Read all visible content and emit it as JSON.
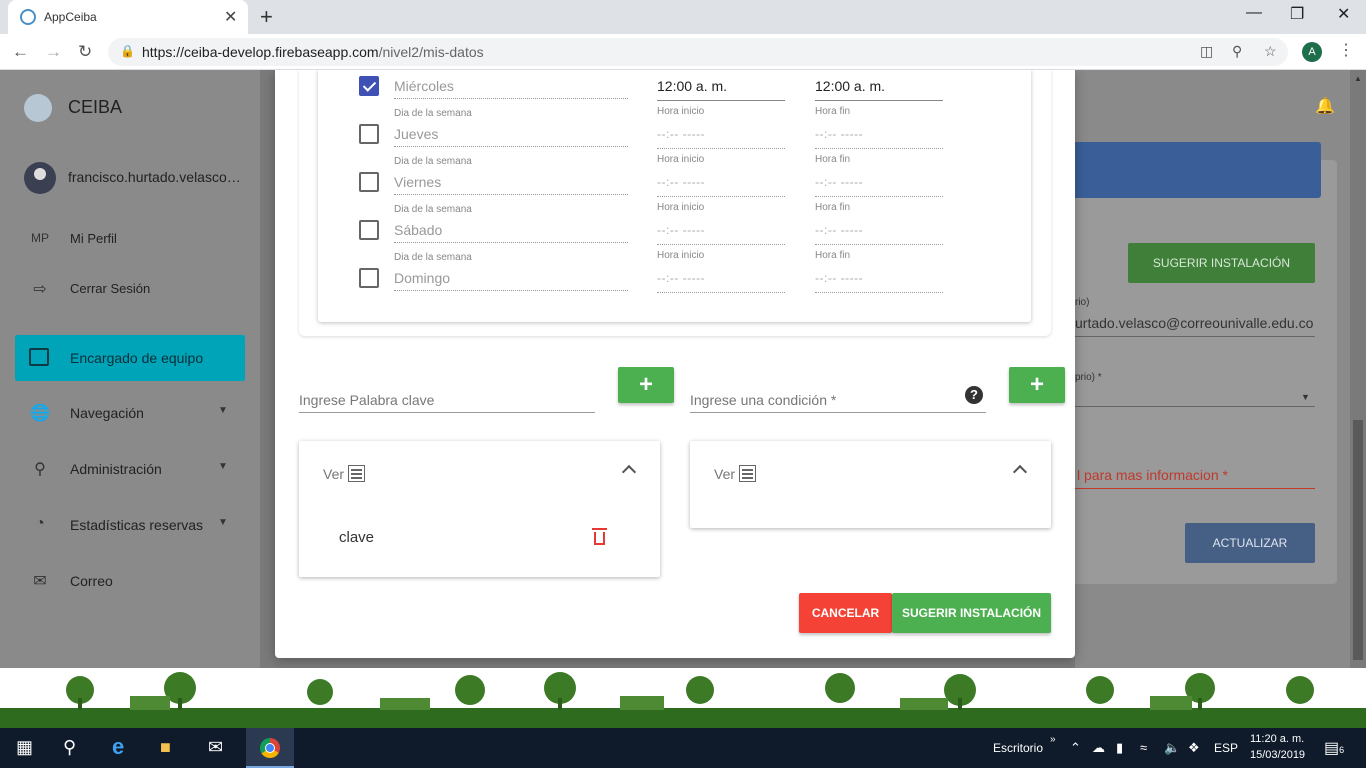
{
  "browser": {
    "tab_title": "AppCeiba",
    "tab_close": "✕",
    "new_tab": "+",
    "url_host": "https://ceiba-develop.firebaseapp.com",
    "url_path": "/nivel2/mis-datos",
    "avatar_letter": "A"
  },
  "sidebar": {
    "brand": "CEIBA",
    "user_name": "francisco.hurtado.velasco@correounivalle.edu.co",
    "profile_initials": "MP",
    "profile_label": "Mi Perfil",
    "logout_label": "Cerrar Sesión",
    "active_item": "Encargado de equipo",
    "items": [
      {
        "label": "Navegación",
        "icon": "globe-icon"
      },
      {
        "label": "Administración",
        "icon": "hierarchy-icon"
      },
      {
        "label": "Estadísticas reservas",
        "icon": "pie-icon"
      },
      {
        "label": "Correo",
        "icon": "mail-icon"
      }
    ]
  },
  "background": {
    "suggest_button": "SUGERIR INSTALACIÓN",
    "field1_label": "rio)",
    "field1_value": "urtado.velasco@correounivalle.edu.co",
    "field2_label": "prio) *",
    "red_field": "l para mas informacion *",
    "update_button": "ACTUALIZAR"
  },
  "schedule": {
    "day_caption": "Dia de la semana",
    "start_caption": "Hora inicio",
    "end_caption": "Hora fin",
    "time_placeholder": "--:-- -----",
    "rows": [
      {
        "day": "Miércoles",
        "checked": true,
        "start": "12:00 a. m.",
        "end": "12:00 a. m."
      },
      {
        "day": "Jueves",
        "checked": false
      },
      {
        "day": "Viernes",
        "checked": false
      },
      {
        "day": "Sábado",
        "checked": false
      },
      {
        "day": "Domingo",
        "checked": false
      }
    ]
  },
  "form": {
    "keyword_placeholder": "Ingrese Palabra clave",
    "condition_placeholder": "Ingrese una condición *",
    "plus": "+",
    "help": "?",
    "panel_label": "Ver",
    "keywords": [
      "clave"
    ],
    "cancel_button": "CANCELAR",
    "submit_button": "SUGERIR INSTALACIÓN"
  },
  "taskbar": {
    "escritorio": "Escritorio",
    "lang": "ESP",
    "time": "11:20 a. m.",
    "date": "15/03/2019",
    "notifications": "6"
  },
  "colors": {
    "accent_teal": "#00a4b8",
    "green": "#4caf50",
    "red": "#f44336",
    "checkbox_blue": "#3f51b5"
  }
}
